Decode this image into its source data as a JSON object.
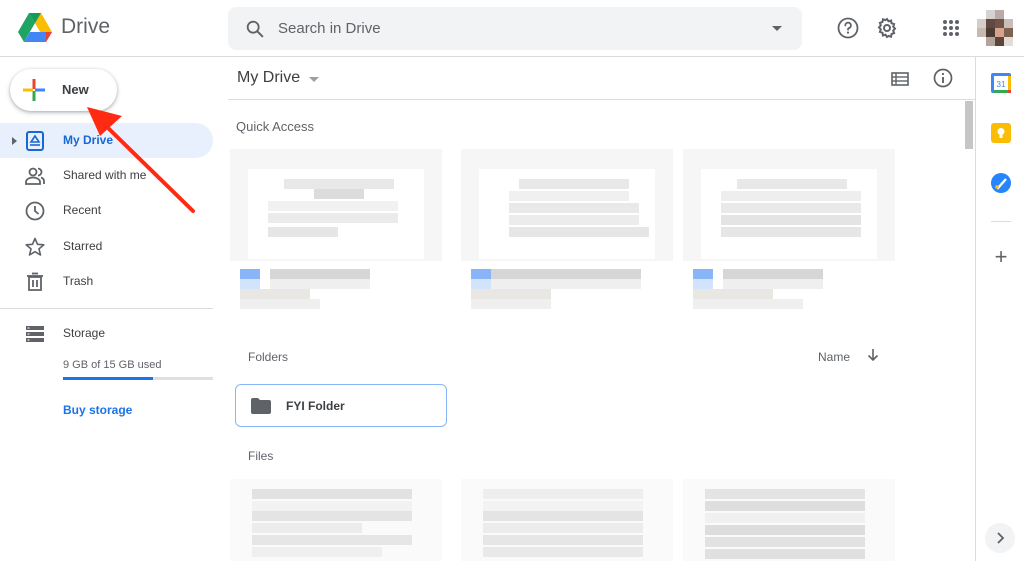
{
  "app": {
    "brand": "Drive"
  },
  "search": {
    "placeholder": "Search in Drive"
  },
  "topbar_icons": [
    "help-icon",
    "settings-icon",
    "apps-grid-icon",
    "account-avatar"
  ],
  "sidebar": {
    "new_label": "New",
    "items": [
      {
        "label": "My Drive",
        "icon": "my-drive-icon",
        "active": true
      },
      {
        "label": "Shared with me",
        "icon": "shared-icon",
        "active": false
      },
      {
        "label": "Recent",
        "icon": "clock-icon",
        "active": false
      },
      {
        "label": "Starred",
        "icon": "star-icon",
        "active": false
      },
      {
        "label": "Trash",
        "icon": "trash-icon",
        "active": false
      }
    ],
    "storage": {
      "label": "Storage",
      "used_text": "9 GB of 15 GB used",
      "used_fraction": 0.6,
      "buy_label": "Buy storage"
    }
  },
  "main": {
    "title": "My Drive",
    "quick_access_label": "Quick Access",
    "folders_label": "Folders",
    "sort_label": "Name",
    "sort_direction": "descending",
    "folders": [
      {
        "name": "FYI Folder"
      }
    ],
    "files_label": "Files"
  },
  "right_panel": {
    "apps": [
      "calendar-icon",
      "keep-icon",
      "tasks-icon"
    ],
    "calendar_day": "31",
    "add_label": "+"
  },
  "annotation": {
    "type": "red-arrow",
    "points_to": "new-button"
  },
  "colors": {
    "accent": "#1a73e8",
    "active_bg": "#e8f0fe",
    "annotation": "#ff2a12"
  }
}
